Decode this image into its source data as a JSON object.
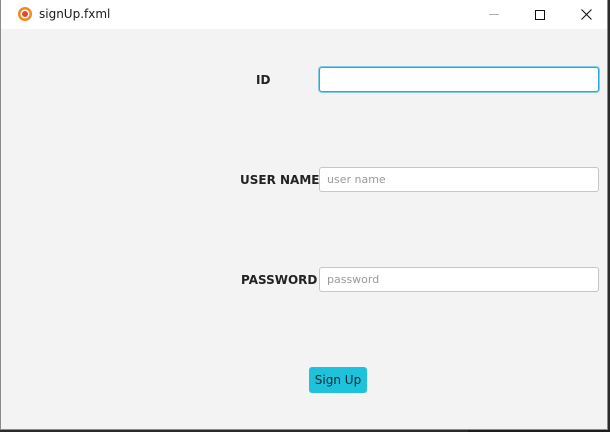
{
  "window": {
    "title": "signUp.fxml",
    "icon": "app-logo-icon",
    "controls": [
      "minimize-icon",
      "maximize-icon",
      "close-icon"
    ],
    "close_glyph": "✕"
  },
  "form": {
    "id_label": "ID",
    "id_value": "",
    "username_label": "USER NAME",
    "username_placeholder": "user name",
    "password_label": "PASSWORD",
    "password_placeholder": "password",
    "submit_label": "Sign Up"
  },
  "colors": {
    "accent": "#1ec2da",
    "focus_border": "#2ea8d8",
    "background": "#f3f3f3"
  }
}
